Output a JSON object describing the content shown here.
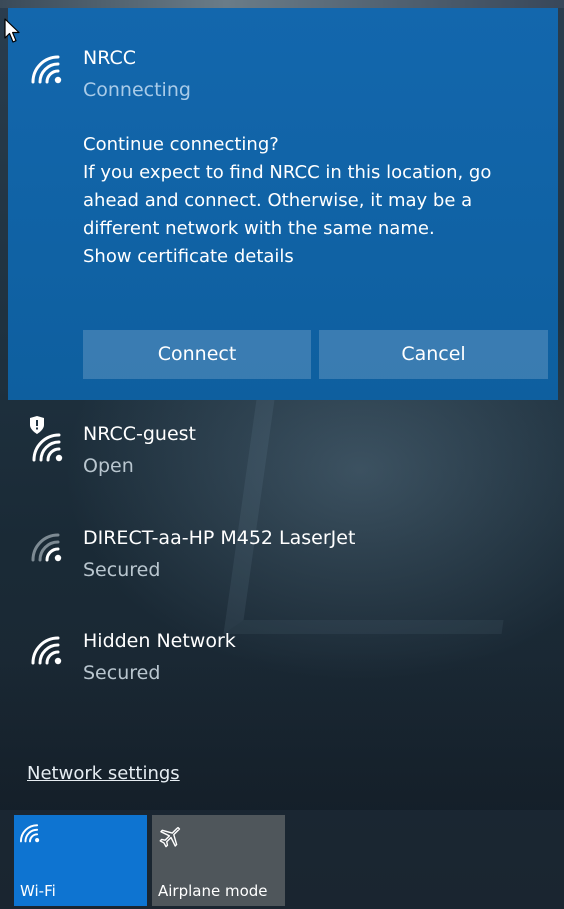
{
  "connecting_network": {
    "name": "NRCC",
    "status": "Connecting",
    "message_lines": [
      "Continue connecting?",
      "If you expect to find NRCC in this location, go",
      "ahead and connect. Otherwise, it may be a",
      "different network with the same name.",
      "Show certificate details"
    ],
    "connect_label": "Connect",
    "cancel_label": "Cancel"
  },
  "networks": [
    {
      "name": "NRCC-guest",
      "status": "Open",
      "icon": "wifi-shield-icon"
    },
    {
      "name": "DIRECT-aa-HP M452 LaserJet",
      "status": "Secured",
      "icon": "wifi-weak-icon"
    },
    {
      "name": "Hidden Network",
      "status": "Secured",
      "icon": "wifi-icon"
    }
  ],
  "settings_link": "Network settings",
  "quick_actions": [
    {
      "label": "Wi-Fi",
      "icon": "wifi-icon",
      "active": true
    },
    {
      "label": "Airplane mode",
      "icon": "airplane-icon",
      "active": false
    }
  ],
  "colors": {
    "accent": "#0e74d1",
    "expanded_background": "#0f63a8",
    "inactive_tile": "#4f565b"
  }
}
